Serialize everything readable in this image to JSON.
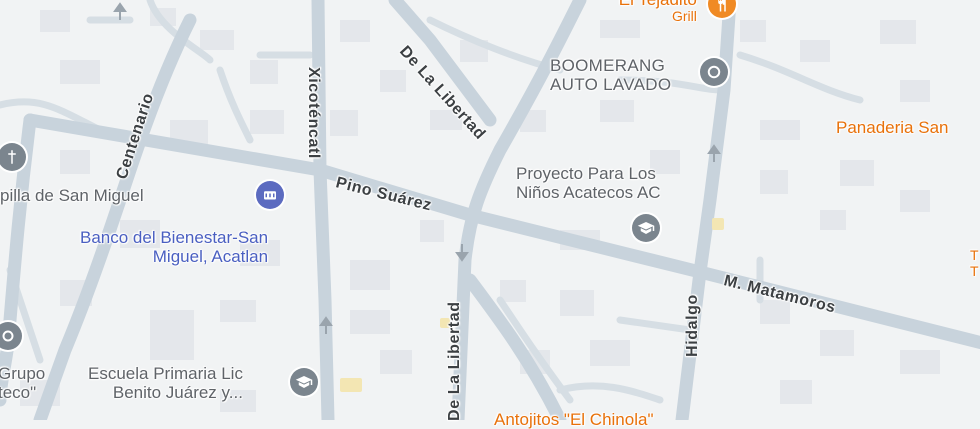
{
  "colors": {
    "background": "#f1f3f4",
    "road": "#c7d3dc",
    "road_minor": "#d5dde3",
    "building": "#e3e6ea",
    "poi_grey": "#5f6368",
    "poi_blue": "#4a5fc1",
    "poi_orange": "#e8710a",
    "street_text": "#3c4043"
  },
  "streets": {
    "pino_suarez": "Pino Suárez",
    "de_la_libertad_top": "De La Libertad",
    "de_la_libertad_bottom": "De La Libertad",
    "xicotencatl": "Xicoténcatl",
    "centenario": "Centenario",
    "m_matamoros": "M. Matamoros",
    "hidalgo": "Hidalgo"
  },
  "places": {
    "el_tejadito": {
      "line1": "El Tejadito",
      "line2": "Grill",
      "icon": "restaurant-icon"
    },
    "boomerang": {
      "line1": "BOOMERANG",
      "line2": "AUTO LAVADO",
      "icon": "car-wash-icon"
    },
    "panaderia": {
      "line1": "Panaderia San",
      "icon": "bakery"
    },
    "proyecto": {
      "line1": "Proyecto Para Los",
      "line2": "Niños Acatecos AC",
      "icon": "school-icon"
    },
    "capilla": {
      "line1": "pilla de San Miguel",
      "icon": "church-icon"
    },
    "banco": {
      "line1": "Banco del Bienestar-San",
      "line2": "Miguel, Acatlan",
      "icon": "bank-icon"
    },
    "escuela": {
      "line1": "Escuela Primaria Lic",
      "line2": "Benito Juárez y...",
      "icon": "school-icon"
    },
    "grupo": {
      "line1": "Grupo",
      "line2": "teco\"",
      "icon": "place-icon"
    },
    "antojitos": {
      "line1": "Antojitos \"El Chinola\"",
      "icon": "restaurant"
    },
    "t_edge": {
      "line1": "T",
      "line2": "T"
    }
  },
  "one_way_arrows": [
    "up",
    "down",
    "up",
    "up"
  ]
}
